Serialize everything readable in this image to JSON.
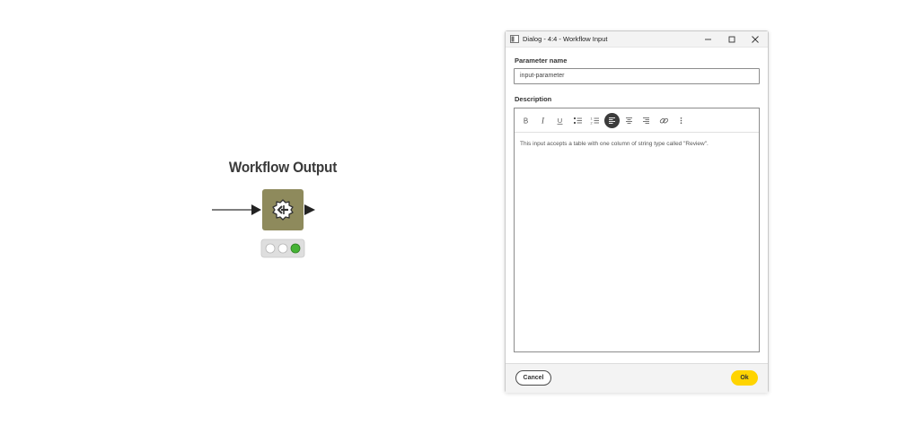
{
  "workflow": {
    "node_title": "Workflow Output",
    "node_color": "#8e8a5c",
    "status": [
      "inactive",
      "inactive",
      "executed"
    ],
    "status_colors": {
      "inactive": "#ffffff",
      "executed": "#45b334"
    }
  },
  "dialog": {
    "title": "Dialog - 4:4 - Workflow Input",
    "window_controls": [
      "minimize-icon",
      "maximize-icon",
      "close-icon"
    ],
    "parameter_name_label": "Parameter name",
    "parameter_name_value": "input-parameter",
    "description_label": "Description",
    "toolbar": [
      "bold-icon",
      "italic-icon",
      "underline-icon",
      "bullet-list-icon",
      "numbered-list-icon",
      "align-left-icon",
      "align-center-icon",
      "align-right-icon",
      "link-icon",
      "more-icon"
    ],
    "active_tool": "align-left-icon",
    "description_text": "This input accepts a table with one column of string type called \"Review\".",
    "cancel_label": "Cancel",
    "ok_label": "Ok",
    "ok_color": "#ffd400"
  }
}
